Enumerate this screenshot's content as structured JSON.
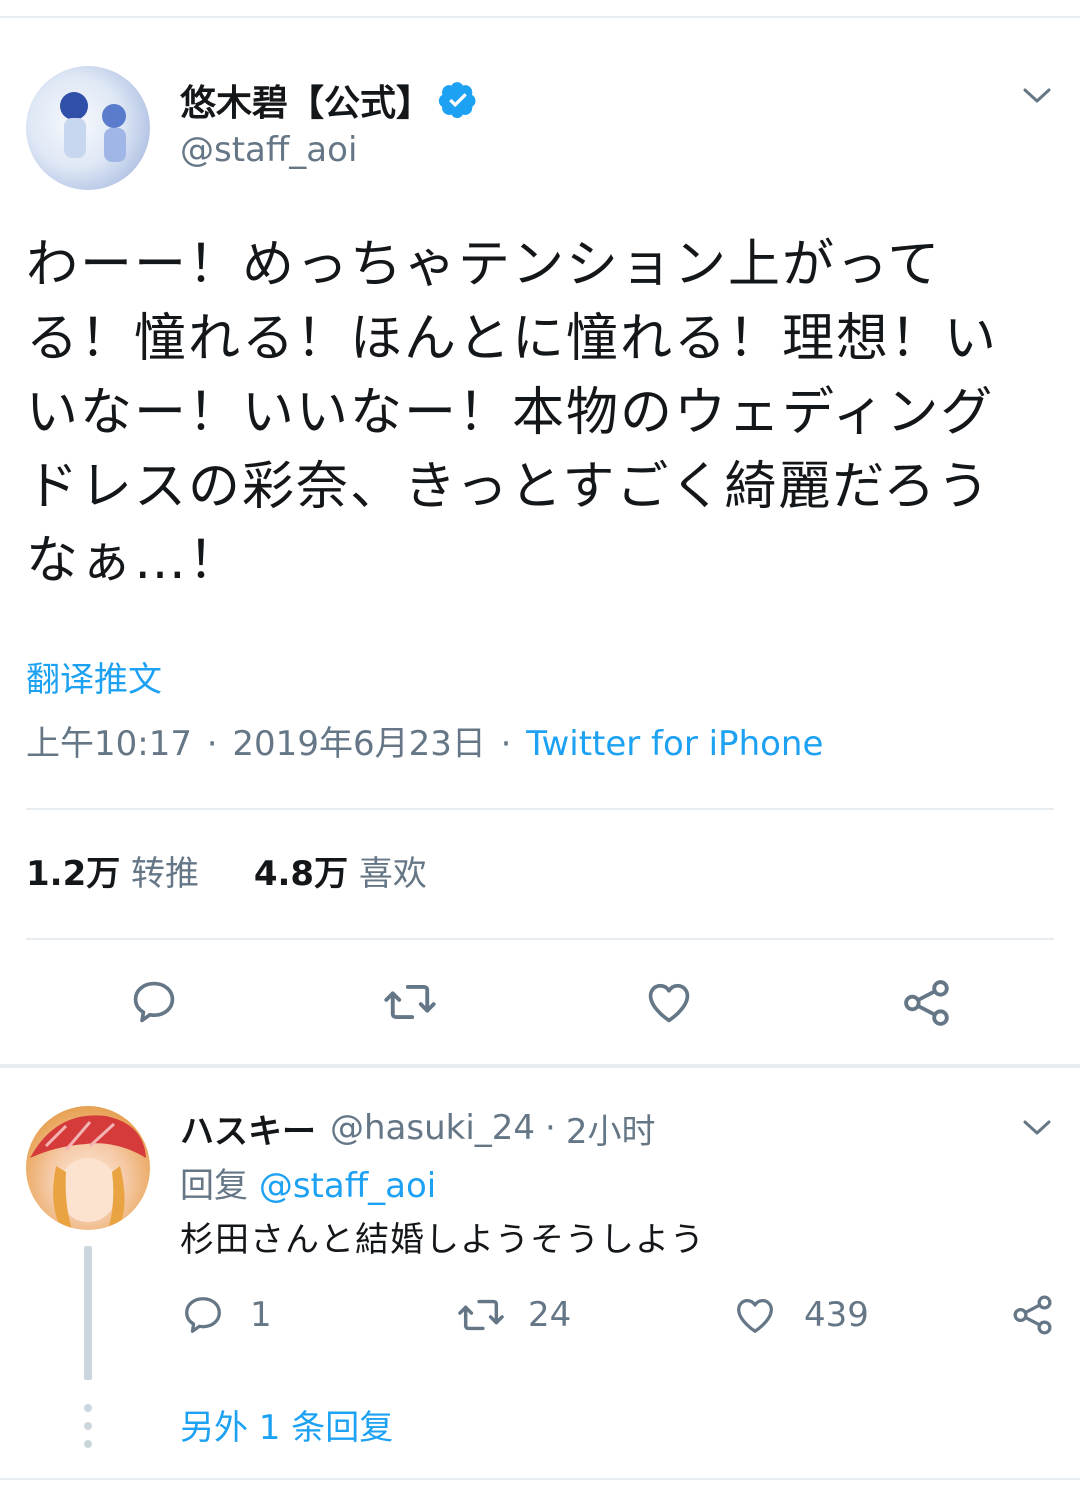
{
  "tweet": {
    "display_name": "悠木碧【公式】",
    "handle": "@staff_aoi",
    "text": "わーー！めっちゃテンション上がってる！憧れる！ほんとに憧れる！理想！いいなー！いいなー！本物のウェディングドレスの彩奈、きっとすごく綺麗だろうなぁ…！",
    "translate_label": "翻译推文",
    "time": "上午10:17",
    "separator1": "·",
    "date": "2019年6月23日",
    "separator2": "·",
    "source": "Twitter for iPhone",
    "retweets_count": "1.2万",
    "retweets_label": "转推",
    "likes_count": "4.8万",
    "likes_label": "喜欢"
  },
  "reply": {
    "display_name": "ハスキー",
    "handle": "@hasuki_24",
    "separator": "·",
    "age": "2小时",
    "replying_prefix": "回复",
    "replying_to": "@staff_aoi",
    "text": "杉田さんと結婚しようそうしよう",
    "reply_count": "1",
    "retweet_count": "24",
    "like_count": "439"
  },
  "more_replies_label": "另外 1 条回复",
  "icons": {
    "verified": "verified-badge-icon",
    "chevron": "chevron-down-icon",
    "reply": "reply-icon",
    "retweet": "retweet-icon",
    "like": "heart-icon",
    "share": "share-icon"
  },
  "colors": {
    "accent": "#1da1f2",
    "secondary_text": "#657786",
    "primary_text": "#14171a",
    "divider": "#e6ecf0"
  }
}
